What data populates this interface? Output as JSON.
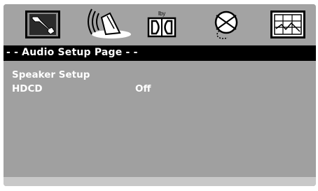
{
  "icon_bar": {
    "tabs": [
      {
        "icon": "wrench-icon"
      },
      {
        "icon": "speaker-icon"
      },
      {
        "icon": "dolby-icon",
        "label": "lby"
      },
      {
        "icon": "globe-icon"
      },
      {
        "icon": "picture-icon"
      }
    ]
  },
  "title_bar": {
    "title": "- - Audio Setup Page - -"
  },
  "menu": {
    "items": [
      {
        "label": "Speaker Setup",
        "value": ""
      },
      {
        "label": "HDCD",
        "value": "Off"
      }
    ]
  },
  "colors": {
    "background": "#9a9a9a",
    "title_bar": "#000000",
    "text": "#ffffff"
  }
}
